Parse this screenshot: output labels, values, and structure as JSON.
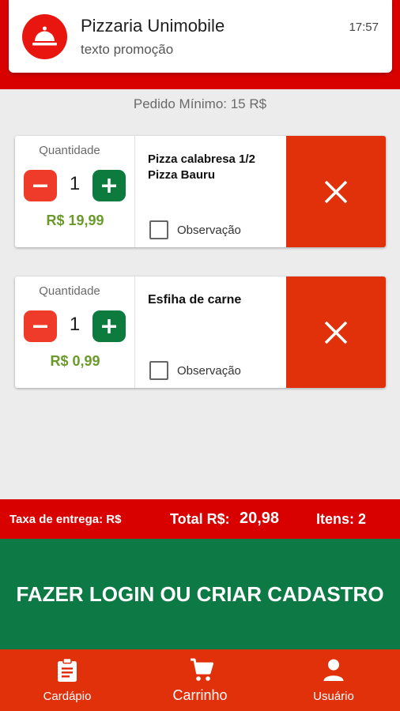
{
  "notification": {
    "title": "Pizzaria Unimobile",
    "subtitle": "texto promoção",
    "time": "17:57",
    "icon": "cloche-icon"
  },
  "minimum_order": "Pedido Mínimo: 15 R$",
  "cart_items": [
    {
      "quantity_label": "Quantidade",
      "quantity": "1",
      "price": "R$ 19,99",
      "name": "Pizza calabresa 1/2 Pizza Bauru",
      "observation_label": "Observação",
      "observation_checked": false
    },
    {
      "quantity_label": "Quantidade",
      "quantity": "1",
      "price": "R$ 0,99",
      "name": "Esfiha de carne",
      "observation_label": "Observação",
      "observation_checked": false
    }
  ],
  "summary": {
    "delivery_fee": "Taxa de entrega: R$",
    "total_label": "Total R$:",
    "total_value": "20,98",
    "items_count": "Itens: 2"
  },
  "login_button": "FAZER LOGIN OU CRIAR CADASTRO",
  "bottom_nav": [
    {
      "label": "Cardápio",
      "icon": "clipboard-icon"
    },
    {
      "label": "Carrinho",
      "icon": "cart-icon"
    },
    {
      "label": "Usuário",
      "icon": "user-icon"
    }
  ],
  "colors": {
    "primary_red": "#d90000",
    "remove_red": "#e0310b",
    "green": "#0d7a45",
    "price_green": "#6a9a2a"
  }
}
